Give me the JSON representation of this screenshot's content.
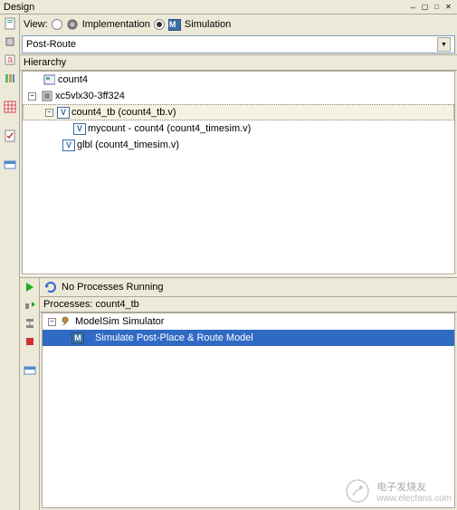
{
  "title": "Design",
  "view": {
    "label": "View:",
    "implementation": "Implementation",
    "simulation": "Simulation",
    "selected": "simulation"
  },
  "dropdown": {
    "value": "Post-Route"
  },
  "hierarchy": {
    "header": "Hierarchy",
    "nodes": {
      "root": "count4",
      "device": "xc5vlx30-3ff324",
      "tb": "count4_tb (count4_tb.v)",
      "mycount": "mycount - count4 (count4_timesim.v)",
      "glbl": "glbl (count4_timesim.v)"
    }
  },
  "status": {
    "text": "No Processes Running"
  },
  "processes": {
    "header": "Processes: count4_tb",
    "simulator": "ModelSim Simulator",
    "action": "Simulate Post-Place & Route Model"
  },
  "watermark": {
    "text": "电子发烧友",
    "url": "www.elecfans.com"
  }
}
